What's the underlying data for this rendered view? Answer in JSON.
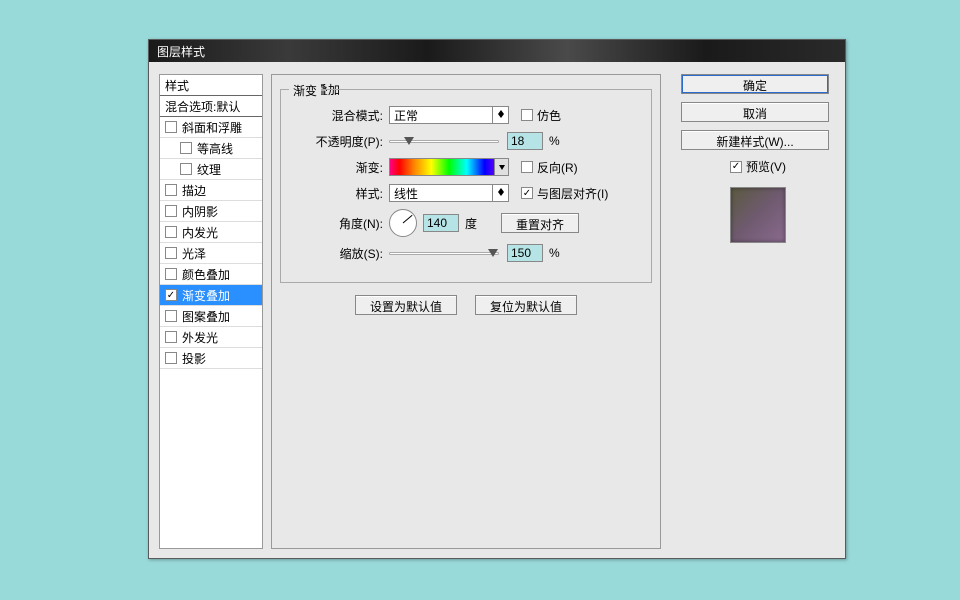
{
  "title": "图层样式",
  "left": {
    "header_style": "样式",
    "header_blend": "混合选项:默认",
    "items": [
      {
        "label": "斜面和浮雕",
        "checked": false,
        "selected": false,
        "indent": false
      },
      {
        "label": "等高线",
        "checked": false,
        "selected": false,
        "indent": true
      },
      {
        "label": "纹理",
        "checked": false,
        "selected": false,
        "indent": true
      },
      {
        "label": "描边",
        "checked": false,
        "selected": false,
        "indent": false
      },
      {
        "label": "内阴影",
        "checked": false,
        "selected": false,
        "indent": false
      },
      {
        "label": "内发光",
        "checked": false,
        "selected": false,
        "indent": false
      },
      {
        "label": "光泽",
        "checked": false,
        "selected": false,
        "indent": false
      },
      {
        "label": "颜色叠加",
        "checked": false,
        "selected": false,
        "indent": false
      },
      {
        "label": "渐变叠加",
        "checked": true,
        "selected": true,
        "indent": false
      },
      {
        "label": "图案叠加",
        "checked": false,
        "selected": false,
        "indent": false
      },
      {
        "label": "外发光",
        "checked": false,
        "selected": false,
        "indent": false
      },
      {
        "label": "投影",
        "checked": false,
        "selected": false,
        "indent": false
      }
    ]
  },
  "center": {
    "section_title": "渐变叠加",
    "group_title": "渐变",
    "blend_mode_label": "混合模式:",
    "blend_mode_value": "正常",
    "dither_label": "仿色",
    "opacity_label": "不透明度(P):",
    "opacity_value": "18",
    "percent": "%",
    "gradient_label": "渐变:",
    "reverse_label": "反向(R)",
    "style_label": "样式:",
    "style_value": "线性",
    "align_label": "与图层对齐(I)",
    "angle_label": "角度(N):",
    "angle_value": "140",
    "angle_unit": "度",
    "reset_align": "重置对齐",
    "scale_label": "缩放(S):",
    "scale_value": "150",
    "make_default": "设置为默认值",
    "reset_default": "复位为默认值"
  },
  "right": {
    "ok": "确定",
    "cancel": "取消",
    "new_style": "新建样式(W)...",
    "preview_label": "预览(V)"
  }
}
